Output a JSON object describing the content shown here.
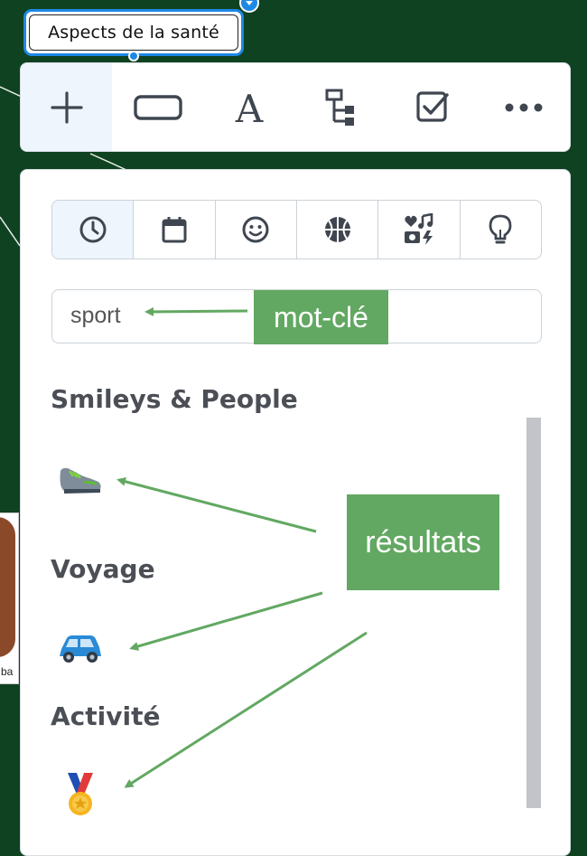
{
  "node": {
    "title": "Aspects de la santé"
  },
  "side_card": {
    "label": "ba"
  },
  "toolbar": {
    "tools": [
      {
        "icon": "plus-icon"
      },
      {
        "icon": "rectangle-icon"
      },
      {
        "icon": "text-a-icon"
      },
      {
        "icon": "hierarchy-icon"
      },
      {
        "icon": "checkbox-icon"
      },
      {
        "icon": "more-dots-icon"
      }
    ]
  },
  "emoji_panel": {
    "category_tabs": [
      {
        "icon": "clock-icon"
      },
      {
        "icon": "calendar-icon"
      },
      {
        "icon": "smiley-icon"
      },
      {
        "icon": "basketball-icon"
      },
      {
        "icon": "heart-music-camera-icon"
      },
      {
        "icon": "lightbulb-icon"
      }
    ],
    "search": {
      "value": "sport"
    },
    "sections": [
      {
        "title": "Smileys & People",
        "emoji": "👟"
      },
      {
        "title": "Voyage",
        "emoji": "🚙"
      },
      {
        "title": "Activité",
        "emoji": "🏅"
      }
    ]
  },
  "annotations": {
    "keyword": "mot-clé",
    "results": "résultats"
  },
  "colors": {
    "background": "#0f4221",
    "accent": "#1e88e5",
    "annotation": "#62a862"
  }
}
